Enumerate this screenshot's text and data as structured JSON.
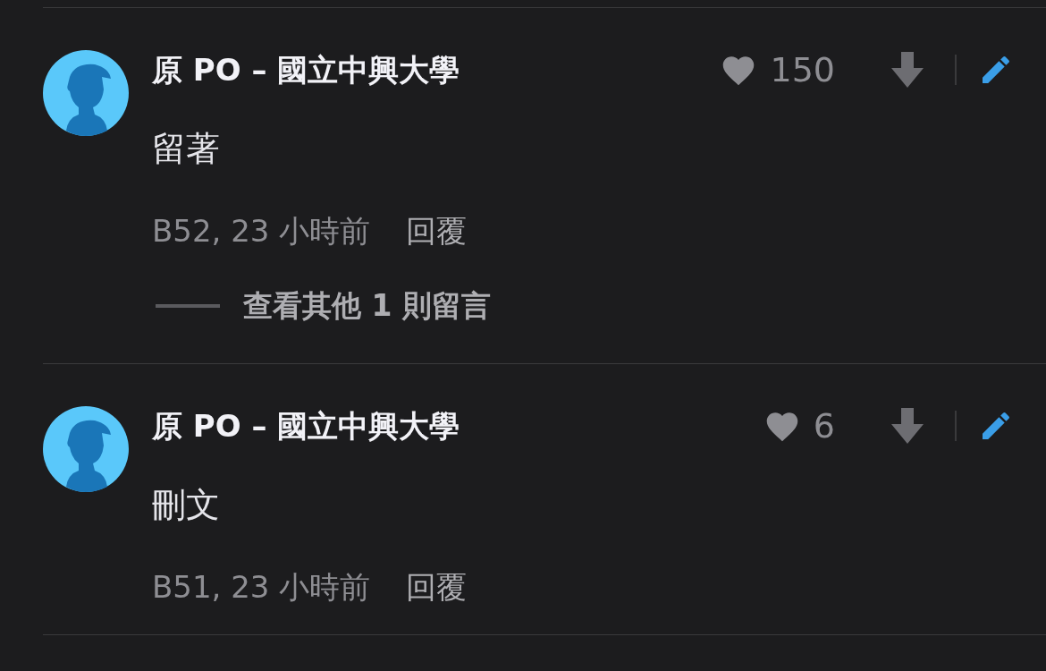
{
  "comments": [
    {
      "author": "原 PO – 國立中興大學",
      "likes": "150",
      "body": "留著",
      "floor": "B52, 23 小時前",
      "reply": "回覆",
      "more_replies": "查看其他 1 則留言"
    },
    {
      "author": "原 PO – 國立中興大學",
      "likes": "6",
      "body": "刪文",
      "floor": "B51, 23 小時前",
      "reply": "回覆"
    }
  ]
}
